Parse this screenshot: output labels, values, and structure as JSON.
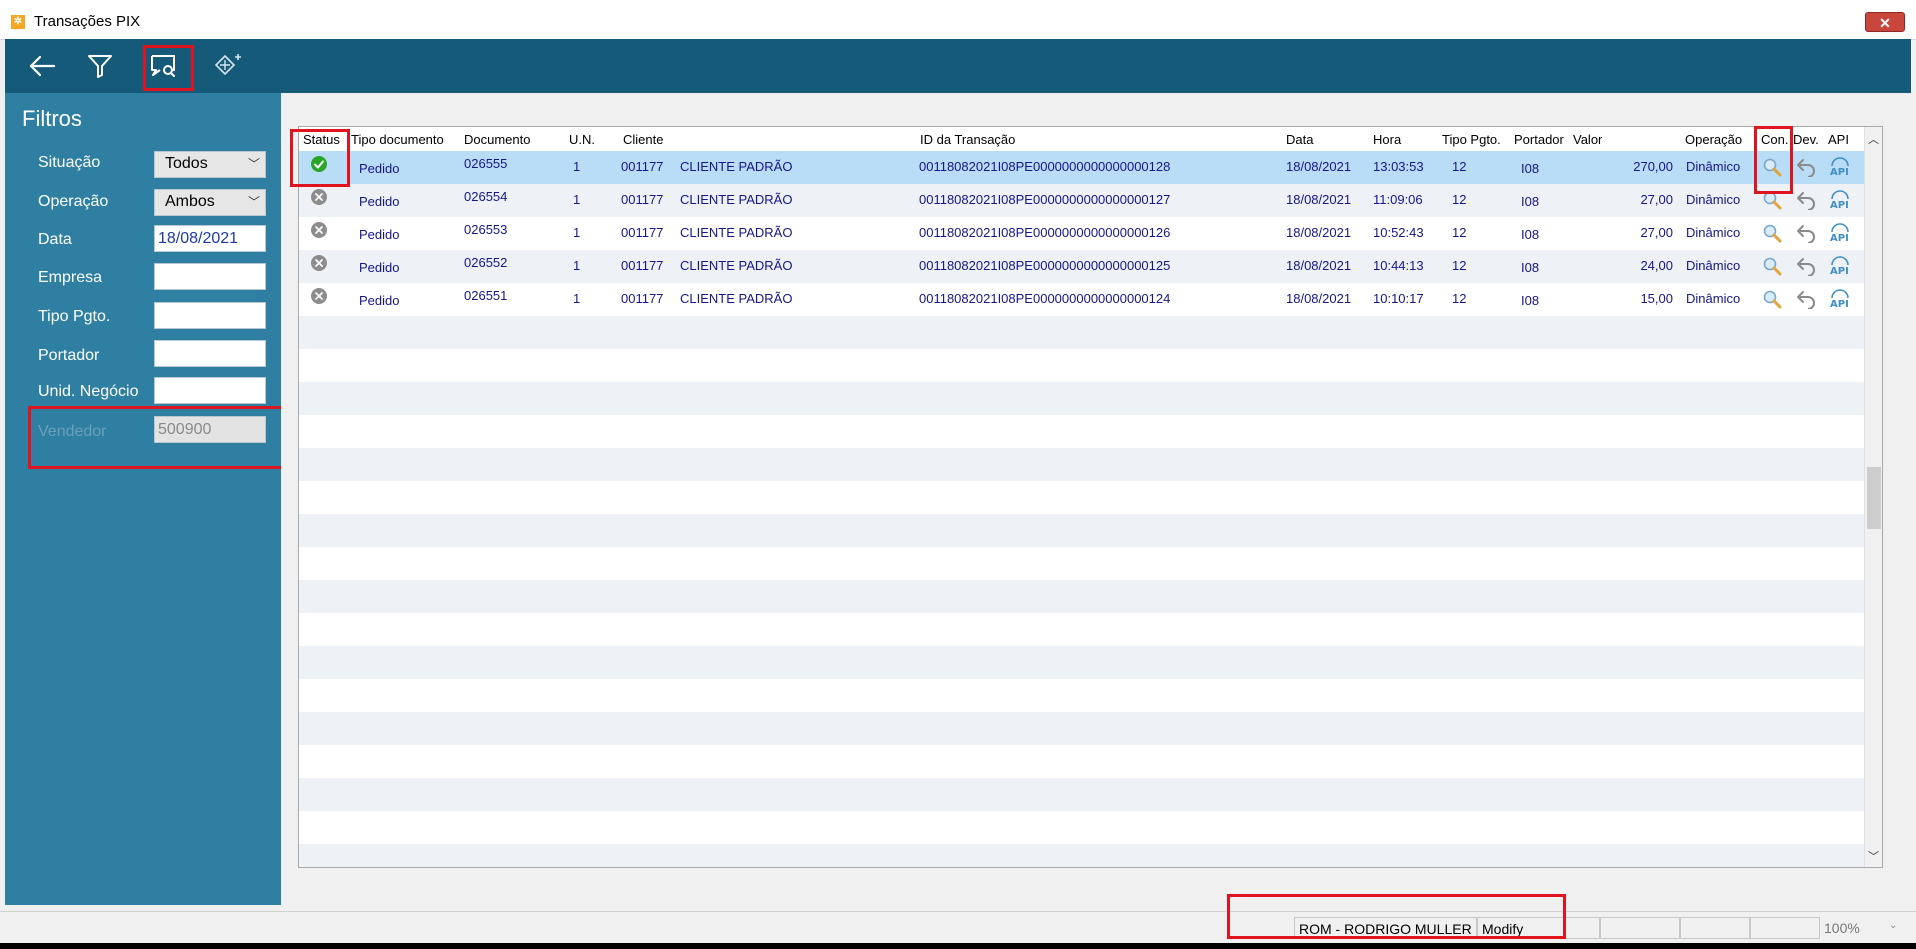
{
  "window": {
    "title": "Transações PIX",
    "close_glyph": "✕"
  },
  "toolbar": {
    "buttons": [
      {
        "icon": "back-arrow-icon"
      },
      {
        "icon": "filter-icon"
      },
      {
        "icon": "search-monitor-icon"
      },
      {
        "icon": "pix-add-icon"
      }
    ]
  },
  "filters": {
    "title": "Filtros",
    "situacao": {
      "label": "Situação",
      "value": "Todos"
    },
    "operacao": {
      "label": "Operação",
      "value": "Ambos"
    },
    "data": {
      "label": "Data",
      "value": "18/08/2021"
    },
    "empresa": {
      "label": "Empresa",
      "value": ""
    },
    "tipo_pgto": {
      "label": "Tipo Pgto.",
      "value": ""
    },
    "portador": {
      "label": "Portador",
      "value": ""
    },
    "unid_negocio": {
      "label": "Unid. Negócio",
      "value": ""
    },
    "vendedor": {
      "label": "Vendedor",
      "value": "500900"
    }
  },
  "grid": {
    "columns": [
      "Status",
      "Tipo documento",
      "Documento",
      "U.N.",
      "Cliente",
      "ID da Transação",
      "Data",
      "Hora",
      "Tipo Pgto.",
      "Portador",
      "Valor",
      "Operação",
      "Con.",
      "Dev.",
      "API"
    ],
    "rows": [
      {
        "status": "ok",
        "tipo": "Pedido",
        "documento": "026555",
        "un": "1",
        "cliente_cod": "001177",
        "cliente_nome": "CLIENTE PADRÃO",
        "id_transacao": "00118082021I08PE0000000000000000128",
        "data": "18/08/2021",
        "hora": "13:03:53",
        "tipo_pgto": "12",
        "portador": "I08",
        "valor": "270,00",
        "operacao": "Dinâmico"
      },
      {
        "status": "error",
        "tipo": "Pedido",
        "documento": "026554",
        "un": "1",
        "cliente_cod": "001177",
        "cliente_nome": "CLIENTE PADRÃO",
        "id_transacao": "00118082021I08PE0000000000000000127",
        "data": "18/08/2021",
        "hora": "11:09:06",
        "tipo_pgto": "12",
        "portador": "I08",
        "valor": "27,00",
        "operacao": "Dinâmico"
      },
      {
        "status": "error",
        "tipo": "Pedido",
        "documento": "026553",
        "un": "1",
        "cliente_cod": "001177",
        "cliente_nome": "CLIENTE PADRÃO",
        "id_transacao": "00118082021I08PE0000000000000000126",
        "data": "18/08/2021",
        "hora": "10:52:43",
        "tipo_pgto": "12",
        "portador": "I08",
        "valor": "27,00",
        "operacao": "Dinâmico"
      },
      {
        "status": "error",
        "tipo": "Pedido",
        "documento": "026552",
        "un": "1",
        "cliente_cod": "001177",
        "cliente_nome": "CLIENTE PADRÃO",
        "id_transacao": "00118082021I08PE0000000000000000125",
        "data": "18/08/2021",
        "hora": "10:44:13",
        "tipo_pgto": "12",
        "portador": "I08",
        "valor": "24,00",
        "operacao": "Dinâmico"
      },
      {
        "status": "error",
        "tipo": "Pedido",
        "documento": "026551",
        "un": "1",
        "cliente_cod": "001177",
        "cliente_nome": "CLIENTE PADRÃO",
        "id_transacao": "00118082021I08PE0000000000000000124",
        "data": "18/08/2021",
        "hora": "10:10:17",
        "tipo_pgto": "12",
        "portador": "I08",
        "valor": "15,00",
        "operacao": "Dinâmico"
      }
    ]
  },
  "statusbar": {
    "user": "ROM - RODRIGO MULLER",
    "mode": "Modify",
    "zoom": "100%"
  },
  "colors": {
    "toolbar": "#165a7a",
    "sidebar": "#2e7fa2",
    "selected_row": "#b9dcf7",
    "highlight": "#e0141e",
    "ok": "#2aa52a",
    "link_text": "#15158d"
  }
}
